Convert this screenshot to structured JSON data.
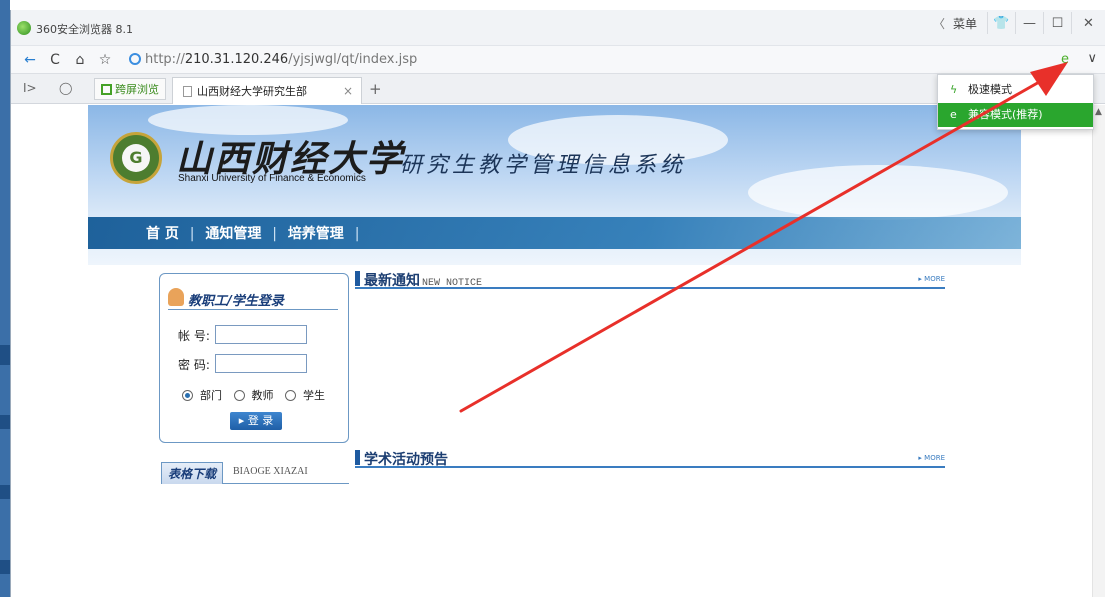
{
  "browser": {
    "title": "360安全浏览器 8.1",
    "menu_label": "菜单",
    "back_chevron": "〈",
    "minimize": "—",
    "maximize": "☐",
    "close": "✕",
    "skin": "👕",
    "url_dim_prefix": "http://",
    "url_host": "210.31.120.246",
    "url_path": "/yjsjwgl/qt/index.jsp",
    "nav": {
      "back": "←",
      "reload": "C",
      "home": "⌂",
      "favorite": "☆"
    },
    "mode_icon": "e",
    "dropdown_chevron": "∨"
  },
  "tabs": {
    "sidebar_toggle": "I>",
    "cloud": "◯",
    "split_view_label": "跨屏浏览",
    "active_tab_label": "山西财经大学研究生部",
    "close_tab": "×",
    "new_tab": "+"
  },
  "mode_menu": {
    "items": [
      {
        "label": "极速模式",
        "icon": "lightning-icon"
      },
      {
        "label": "兼容模式(推荐)",
        "icon": "ie-icon"
      }
    ],
    "active_index": 1
  },
  "banner": {
    "logo_letter": "G",
    "university_cn": "山西财经大学",
    "university_en": "Shanxi University of Finance & Economics",
    "system_title": "研究生教学管理信息系统",
    "nav": [
      "首 页",
      "通知管理",
      "培养管理"
    ],
    "nav_sep": "|"
  },
  "login": {
    "title": "教职工/学生登录",
    "account_label": "帐 号:",
    "password_label": "密 码:",
    "roles": [
      "部门",
      "教师",
      "学生"
    ],
    "selected_role": 0,
    "submit_label": "▸ 登 录"
  },
  "downloads": {
    "title": "表格下载",
    "subtitle": "BIAOGE XIAZAI"
  },
  "sections": {
    "notices": {
      "title": "最新通知",
      "subtitle": "NEW NOTICE",
      "more": "▸ MORE"
    },
    "academic": {
      "title": "学术活动预告",
      "subtitle": "",
      "more": "▸ MORE"
    }
  },
  "annotation_color": "#e8302a"
}
